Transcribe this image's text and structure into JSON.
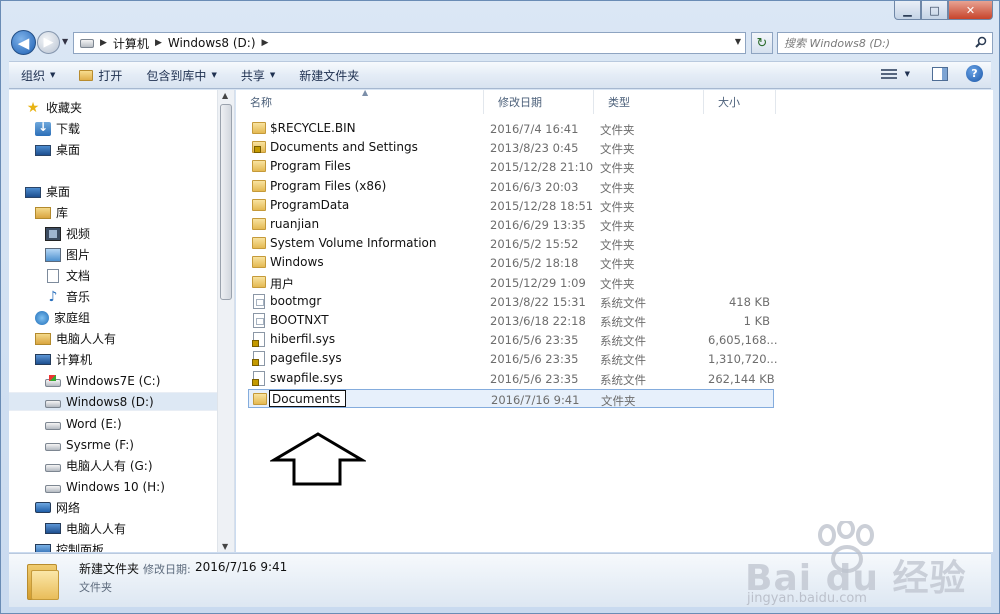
{
  "window": {
    "caption": {
      "minimize": "▁",
      "maximize": "□",
      "close": "✕"
    }
  },
  "address": {
    "back_glyph": "◀",
    "forward_glyph": "▶",
    "recent_glyph": "▼",
    "sep": "▶",
    "crumbs": [
      "计算机",
      "Windows8 (D:)"
    ],
    "dropdown_glyph": "▼",
    "refresh_glyph": "↻",
    "search_placeholder": "搜索 Windows8 (D:)"
  },
  "toolbar": {
    "organize": "组织",
    "open": "打开",
    "include_library": "包含到库中",
    "share": "共享",
    "new_folder": "新建文件夹",
    "caret": "▼",
    "help_glyph": "?"
  },
  "nav": {
    "favorites": "收藏夹",
    "downloads": "下载",
    "desktop_fav": "桌面",
    "desktop": "桌面",
    "libraries": "库",
    "videos": "视频",
    "pictures": "图片",
    "documents": "文档",
    "music": "音乐",
    "homegroup": "家庭组",
    "user": "电脑人人有",
    "computer": "计算机",
    "drive_c": "Windows7E (C:)",
    "drive_d": "Windows8 (D:)",
    "drive_e": "Word (E:)",
    "drive_f": "Sysrme (F:)",
    "drive_g": "电脑人人有 (G:)",
    "drive_h": "Windows 10 (H:)",
    "network": "网络",
    "network_pc": "电脑人人有",
    "control_panel": "控制面板",
    "scroll_up": "▲",
    "scroll_down": "▼"
  },
  "columns": {
    "name": "名称",
    "modified": "修改日期",
    "type": "类型",
    "size": "大小",
    "sort_glyph": "▲"
  },
  "files": [
    {
      "name": "$RECYCLE.BIN",
      "date": "2016/7/4 16:41",
      "type": "文件夹",
      "size": "",
      "icon": "folder-icon"
    },
    {
      "name": "Documents and Settings",
      "date": "2013/8/23 0:45",
      "type": "文件夹",
      "size": "",
      "icon": "locked-folder-icon"
    },
    {
      "name": "Program Files",
      "date": "2015/12/28 21:10",
      "type": "文件夹",
      "size": "",
      "icon": "folder-icon"
    },
    {
      "name": "Program Files (x86)",
      "date": "2016/6/3 20:03",
      "type": "文件夹",
      "size": "",
      "icon": "folder-icon"
    },
    {
      "name": "ProgramData",
      "date": "2015/12/28 18:51",
      "type": "文件夹",
      "size": "",
      "icon": "folder-icon"
    },
    {
      "name": "ruanjian",
      "date": "2016/6/29 13:35",
      "type": "文件夹",
      "size": "",
      "icon": "folder-icon"
    },
    {
      "name": "System Volume Information",
      "date": "2016/5/2 15:52",
      "type": "文件夹",
      "size": "",
      "icon": "folder-icon"
    },
    {
      "name": "Windows",
      "date": "2016/5/2 18:18",
      "type": "文件夹",
      "size": "",
      "icon": "folder-icon"
    },
    {
      "name": "用户",
      "date": "2015/12/29 1:09",
      "type": "文件夹",
      "size": "",
      "icon": "folder-icon"
    },
    {
      "name": "bootmgr",
      "date": "2013/8/22 15:31",
      "type": "系统文件",
      "size": "418 KB",
      "icon": "sysfile-icon"
    },
    {
      "name": "BOOTNXT",
      "date": "2013/6/18 22:18",
      "type": "系统文件",
      "size": "1 KB",
      "icon": "sysfile-icon"
    },
    {
      "name": "hiberfil.sys",
      "date": "2016/5/6 23:35",
      "type": "系统文件",
      "size": "6,605,168...",
      "icon": "locked-sysfile-icon"
    },
    {
      "name": "pagefile.sys",
      "date": "2016/5/6 23:35",
      "type": "系统文件",
      "size": "1,310,720...",
      "icon": "locked-sysfile-icon"
    },
    {
      "name": "swapfile.sys",
      "date": "2016/5/6 23:35",
      "type": "系统文件",
      "size": "262,144 KB",
      "icon": "locked-sysfile-icon"
    }
  ],
  "renaming": {
    "value": "Documents",
    "date": "2016/7/16 9:41",
    "type": "文件夹"
  },
  "details": {
    "name": "新建文件夹",
    "date_label": "修改日期:",
    "date_value": "2016/7/16 9:41",
    "type": "文件夹"
  },
  "watermark": {
    "brand": "Bai du 经验",
    "url": "jingyan.baidu.com"
  }
}
